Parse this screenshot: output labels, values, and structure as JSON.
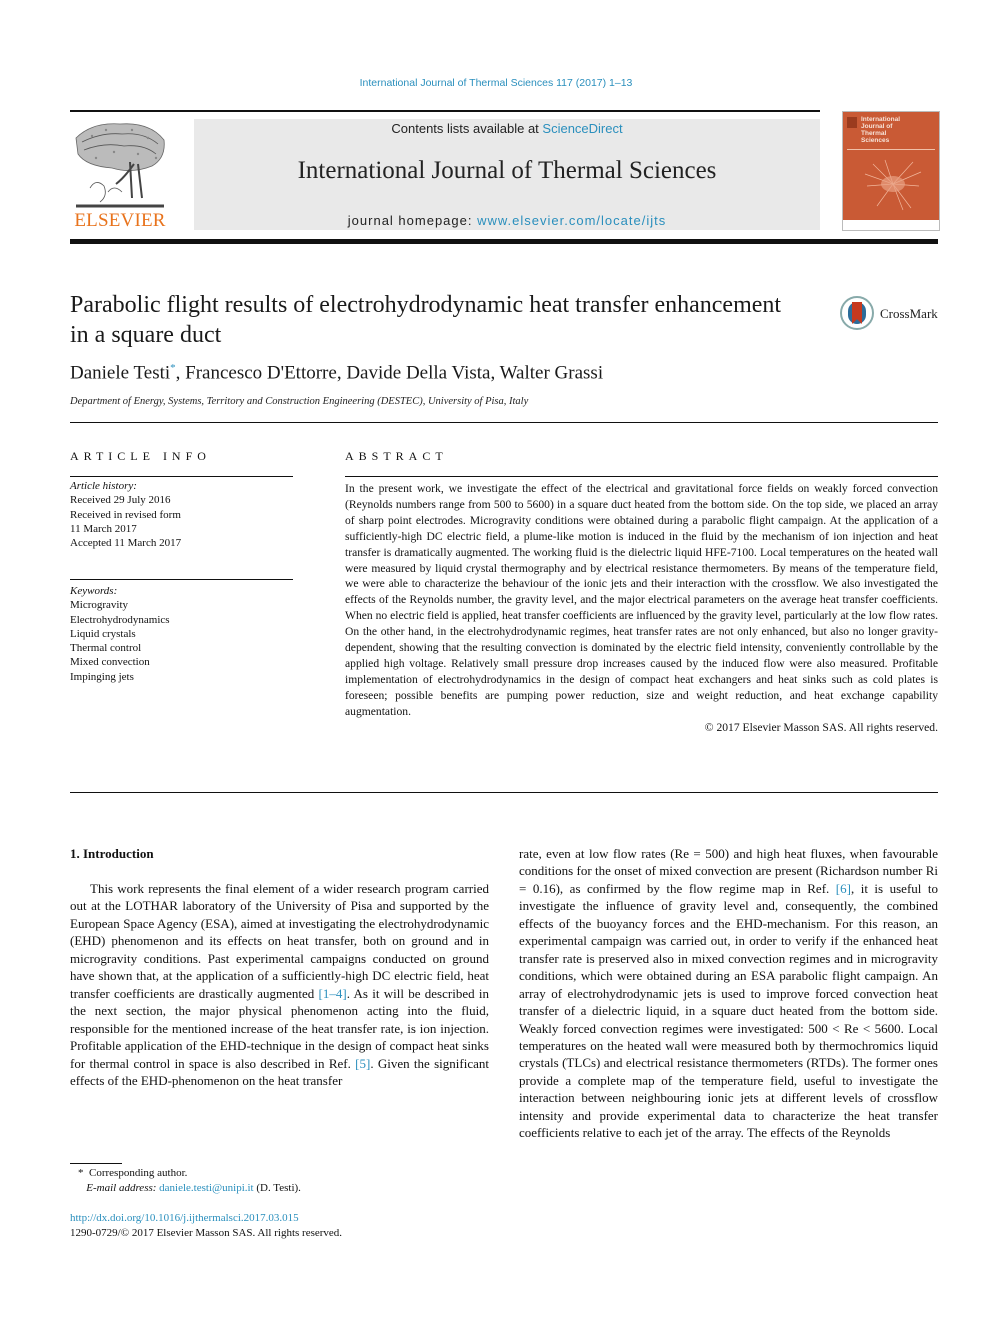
{
  "running_head": "International Journal of Thermal Sciences 117 (2017) 1–13",
  "publisher": {
    "logo_text": "ELSEVIER",
    "logo_icon": "elsevier-tree-icon"
  },
  "masthead": {
    "contents_prefix": "Contents lists available at ",
    "contents_link": "ScienceDirect",
    "journal_title": "International Journal of Thermal Sciences",
    "homepage_prefix": "journal homepage: ",
    "homepage_link": "www.elsevier.com/locate/ijts",
    "cover_title": "International\nJournal of\nThermal\nSciences"
  },
  "article": {
    "title": "Parabolic flight results of electrohydrodynamic heat transfer enhancement in a square duct",
    "crossmark_label": "CrossMark",
    "authors": [
      {
        "name": "Daniele Testi",
        "mark": "*"
      },
      {
        "name": "Francesco D'Ettorre",
        "mark": ""
      },
      {
        "name": "Davide Della Vista",
        "mark": ""
      },
      {
        "name": "Walter Grassi",
        "mark": ""
      }
    ],
    "author_sep": ", ",
    "affiliation": "Department of Energy, Systems, Territory and Construction Engineering (DESTEC), University of Pisa, Italy"
  },
  "article_info": {
    "heading": "ARTICLE INFO",
    "history_label": "Article history:",
    "history": [
      "Received 29 July 2016",
      "Received in revised form",
      "11 March 2017",
      "Accepted 11 March 2017"
    ],
    "keywords_label": "Keywords:",
    "keywords": [
      "Microgravity",
      "Electrohydrodynamics",
      "Liquid crystals",
      "Thermal control",
      "Mixed convection",
      "Impinging jets"
    ]
  },
  "abstract": {
    "heading": "ABSTRACT",
    "text": "In the present work, we investigate the effect of the electrical and gravitational force fields on weakly forced convection (Reynolds numbers range from 500 to 5600) in a square duct heated from the bottom side. On the top side, we placed an array of sharp point electrodes. Microgravity conditions were obtained during a parabolic flight campaign. At the application of a sufficiently-high DC electric field, a plume-like motion is induced in the fluid by the mechanism of ion injection and heat transfer is dramatically augmented. The working fluid is the dielectric liquid HFE-7100. Local temperatures on the heated wall were measured by liquid crystal thermography and by electrical resistance thermometers. By means of the temperature field, we were able to characterize the behaviour of the ionic jets and their interaction with the crossflow. We also investigated the effects of the Reynolds number, the gravity level, and the major electrical parameters on the average heat transfer coefficients. When no electric field is applied, heat transfer coefficients are influenced by the gravity level, particularly at the low flow rates. On the other hand, in the electrohydrodynamic regimes, heat transfer rates are not only enhanced, but also no longer gravity-dependent, showing that the resulting convection is dominated by the electric field intensity, conveniently controllable by the applied high voltage. Relatively small pressure drop increases caused by the induced flow were also measured. Profitable implementation of electrohydrodynamics in the design of compact heat exchangers and heat sinks such as cold plates is foreseen; possible benefits are pumping power reduction, size and weight reduction, and heat exchange capability augmentation.",
    "copyright": "© 2017 Elsevier Masson SAS. All rights reserved."
  },
  "introduction": {
    "heading": "1.  Introduction",
    "left_col": [
      {
        "t": "This work represents the final element of a wider research program carried out at the LOTHAR laboratory of the University of Pisa and supported by the European Space Agency (ESA), aimed at investigating the electrohydrodynamic (EHD) phenomenon and its effects on heat transfer, both on ground and in microgravity conditions. Past experimental campaigns conducted on ground have shown that, at the application of a sufficiently-high DC electric field, heat transfer coefficients are drastically augmented "
      },
      {
        "ref": "[1–4]"
      },
      {
        "t": ". As it will be described in the next section, the major physical phenomenon acting into the fluid, responsible for the mentioned increase of the heat transfer rate, is ion injection. Profitable application of the EHD-technique in the design of compact heat sinks for thermal control in space is also described in Ref. "
      },
      {
        "ref": "[5]"
      },
      {
        "t": ". Given the significant effects of the EHD-phenomenon on the heat transfer"
      }
    ],
    "right_col": [
      {
        "t": "rate, even at low flow rates (Re = 500) and high heat fluxes, when favourable conditions for the onset of mixed convection are present (Richardson number Ri = 0.16), as confirmed by the flow regime map in Ref. "
      },
      {
        "ref": "[6]"
      },
      {
        "t": ", it is useful to investigate the influence of gravity level and, consequently, the combined effects of the buoyancy forces and the EHD-mechanism. For this reason, an experimental campaign was carried out, in order to verify if the enhanced heat transfer rate is preserved also in mixed convection regimes and in microgravity conditions, which were obtained during an ESA parabolic flight campaign. An array of electrohydrodynamic jets is used to improve forced convection heat transfer of a dielectric liquid, in a square duct heated from the bottom side. Weakly forced convection regimes were investigated: 500 < Re < 5600. Local temperatures on the heated wall were measured both by thermochromics liquid crystals (TLCs) and electrical resistance thermometers (RTDs). The former ones provide a complete map of the temperature field, useful to investigate the interaction between neighbouring ionic jets at different levels of crossflow intensity and provide experimental data to characterize the heat transfer coefficients relative to each jet of the array. The effects of the Reynolds"
      }
    ]
  },
  "footnotes": {
    "mark": "*",
    "corresponding": "Corresponding author.",
    "email_label": "E-mail address:",
    "email": "daniele.testi@unipi.it",
    "email_suffix": " (D. Testi)."
  },
  "doi": {
    "url": "http://dx.doi.org/10.1016/j.ijthermalsci.2017.03.015",
    "issn_line": "1290-0729/© 2017 Elsevier Masson SAS. All rights reserved."
  },
  "colors": {
    "link": "#2a8fbd",
    "elsevier_orange": "#e8731c",
    "masthead_bg": "#e9e9e9",
    "cover": "#c95a35"
  }
}
